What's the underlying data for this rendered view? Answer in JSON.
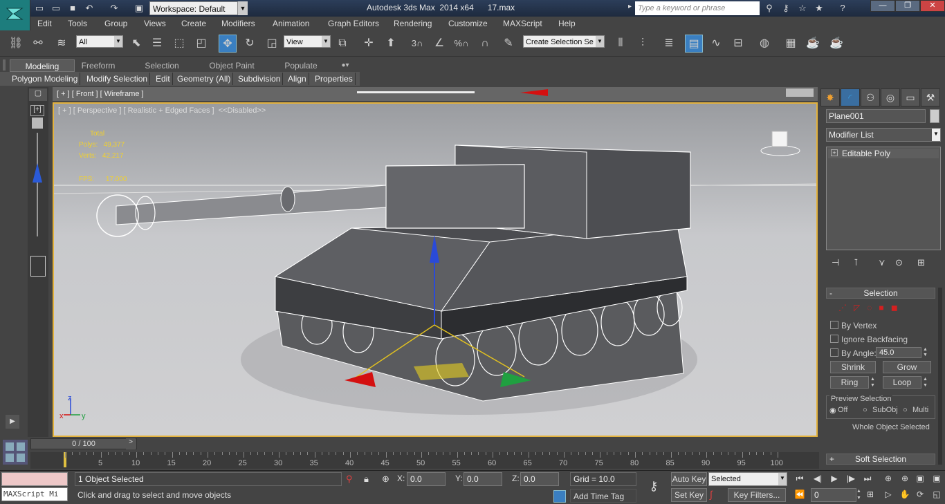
{
  "title": {
    "app": "Autodesk 3ds Max  2014 x64",
    "file": "17.max",
    "workspace": "Workspace: Default",
    "search_placeholder": "Type a keyword or phrase"
  },
  "menu": [
    "Edit",
    "Tools",
    "Group",
    "Views",
    "Create",
    "Modifiers",
    "Animation",
    "Graph Editors",
    "Rendering",
    "Customize",
    "MAXScript",
    "Help"
  ],
  "toolbar": {
    "filter": "All",
    "refcoord": "View",
    "selset": "Create Selection Se",
    "snap_angle": "3",
    "snap_pct": "%"
  },
  "ribbon": {
    "tabs": [
      "Modeling",
      "Freeform",
      "Selection",
      "Object Paint",
      "Populate"
    ],
    "subtabs": [
      "Polygon Modeling",
      "Modify Selection",
      "Edit",
      "Geometry (All)",
      "Subdivision",
      "Align",
      "Properties"
    ]
  },
  "viewport": {
    "top_label": "[ + ] [ Front ] [ Wireframe ]",
    "label": "[ + ] [ Perspective ] [ Realistic + Edged Faces ]  <<Disabled>>",
    "stats_header": "Total",
    "polys_label": "Polys:",
    "polys_value": "49,377",
    "verts_label": "Verts:",
    "verts_value": "42,217",
    "fps_label": "FPS:",
    "fps_value": "17.000",
    "axis_x": "x",
    "axis_y": "y",
    "axis_z": "z"
  },
  "panel": {
    "object_name": "Plane001",
    "modifier_list": "Modifier List",
    "stack_item": "Editable Poly",
    "selection_title": "Selection",
    "by_vertex": "By Vertex",
    "ignore_backfacing": "Ignore Backfacing",
    "by_angle": "By Angle:",
    "angle_value": "45.0",
    "shrink": "Shrink",
    "grow": "Grow",
    "ring": "Ring",
    "loop": "Loop",
    "preview_selection": "Preview Selection",
    "off": "Off",
    "subobj": "SubObj",
    "multi": "Multi",
    "whole_object": "Whole Object Selected",
    "soft_selection": "Soft Selection"
  },
  "timeline": {
    "frame": "0 / 100",
    "ticks": [
      "5",
      "10",
      "15",
      "20",
      "25",
      "30",
      "35",
      "40",
      "45",
      "50",
      "55",
      "60",
      "65",
      "70",
      "75",
      "80",
      "85",
      "90",
      "95",
      "100"
    ]
  },
  "status": {
    "maxscript": "MAXScript Mi",
    "selected": "1 Object Selected",
    "prompt": "Click and drag to select and move objects",
    "x_label": "X:",
    "x_value": "0.0",
    "y_label": "Y:",
    "y_value": "0.0",
    "z_label": "Z:",
    "z_value": "0.0",
    "grid": "Grid = 10.0",
    "add_time_tag": "Add Time Tag",
    "auto_key": "Auto Key",
    "set_key": "Set Key",
    "key_mode": "Selected",
    "key_filters": "Key Filters...",
    "frame_field": "0"
  }
}
